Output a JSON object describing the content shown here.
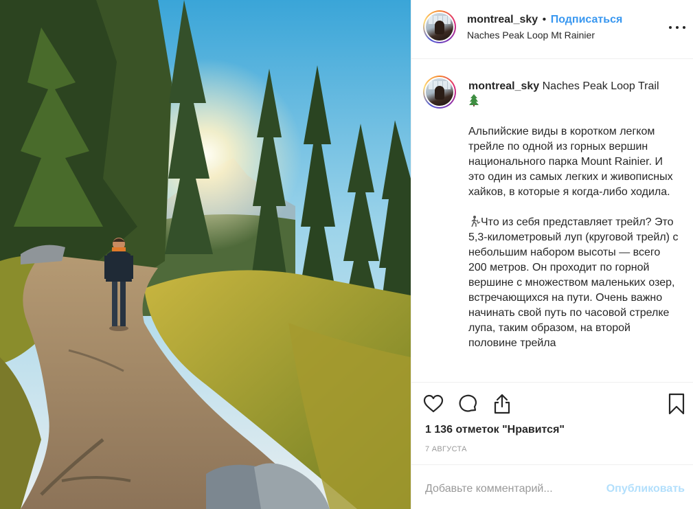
{
  "post": {
    "username": "montreal_sky",
    "separator": "•",
    "follow_label": "Подписаться",
    "location": "Naches Peak Loop Mt Rainier"
  },
  "caption": {
    "username": "montreal_sky",
    "first_line": "Naches Peak Loop Trail",
    "tree_emoji": "tree-emoji",
    "paragraph_1": "Альпийские виды в коротком легком трейле по одной из горных вершин национального парка Mount Rainier. И это один из самых легких и живописных хайков, в которые я когда-либо ходила.",
    "hiker_emoji": "hiker-emoji",
    "paragraph_2": "Что из себя представляет трейл? Это 5,3-километровый луп (круговой трейл) с небольшим набором высоты — всего 200 метров. Он проходит по горной вершине с множеством маленьких озер, встречающихся на пути. Очень важно начинать свой путь по часовой стрелке лупа, таким образом, на второй половине трейла"
  },
  "actions": {
    "like_icon": "heart-icon",
    "comment_icon": "comment-icon",
    "share_icon": "share-icon",
    "save_icon": "bookmark-icon"
  },
  "likes_text": "1 136 отметок \"Нравится\"",
  "date_text": "7 АВГУСТА",
  "comment": {
    "placeholder": "Добавьте комментарий...",
    "publish_label": "Опубликовать"
  },
  "colors": {
    "link_blue": "#3897f0",
    "publish_disabled": "#b2dffc",
    "text_primary": "#262626",
    "text_secondary": "#999999",
    "divider": "#efefef"
  }
}
